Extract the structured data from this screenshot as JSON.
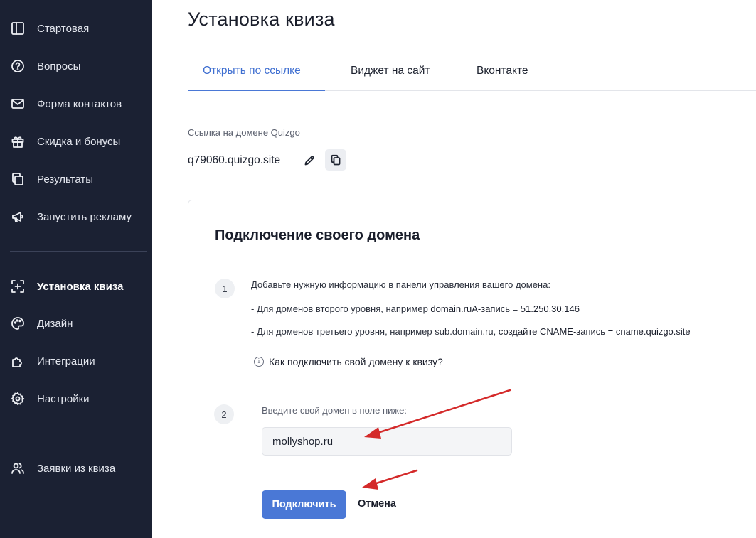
{
  "sidebar": {
    "items": [
      {
        "label": "Стартовая",
        "icon": "layout-icon"
      },
      {
        "label": "Вопросы",
        "icon": "question-icon"
      },
      {
        "label": "Форма контактов",
        "icon": "envelope-icon"
      },
      {
        "label": "Скидка и бонусы",
        "icon": "gift-icon"
      },
      {
        "label": "Результаты",
        "icon": "copy-icon"
      },
      {
        "label": "Запустить рекламу",
        "icon": "megaphone-icon"
      },
      {
        "label": "Установка квиза",
        "icon": "install-icon",
        "active": true
      },
      {
        "label": "Дизайн",
        "icon": "palette-icon"
      },
      {
        "label": "Интеграции",
        "icon": "puzzle-icon"
      },
      {
        "label": "Настройки",
        "icon": "gear-icon"
      },
      {
        "label": "Заявки из квиза",
        "icon": "users-icon"
      }
    ]
  },
  "header": {
    "title": "Установка квиза"
  },
  "tabs": [
    {
      "label": "Открыть по ссылке",
      "active": true
    },
    {
      "label": "Виджет на сайт"
    },
    {
      "label": "Вконтакте"
    }
  ],
  "link": {
    "label": "Ссылка на домене Quizgo",
    "value": "q79060.quizgo.site"
  },
  "custom_domain": {
    "title": "Подключение своего домена",
    "step1": {
      "number": "1",
      "intro": "Добавьте нужную информацию в панели управления вашего домена:",
      "line1_prefix": "- Для доменов второго уровня, например ",
      "line1_bold": "domain.ruA-запись = 51.250.30.146",
      "line2_prefix": "- Для доменов третьего уровня, например sub.domain.ru, ",
      "line2_bold": "создайте CNAME-запись = cname.quizgo.site"
    },
    "help_link": "Как подключить свой домену к квизу?",
    "step2": {
      "number": "2",
      "label": "Введите свой домен в поле ниже:",
      "input_value": "mollyshop.ru"
    },
    "connect_label": "Подключить",
    "cancel_label": "Отмена"
  },
  "colors": {
    "sidebar_bg": "#1b2133",
    "accent": "#4a78d6",
    "annotation_arrow": "#d42a2a"
  }
}
